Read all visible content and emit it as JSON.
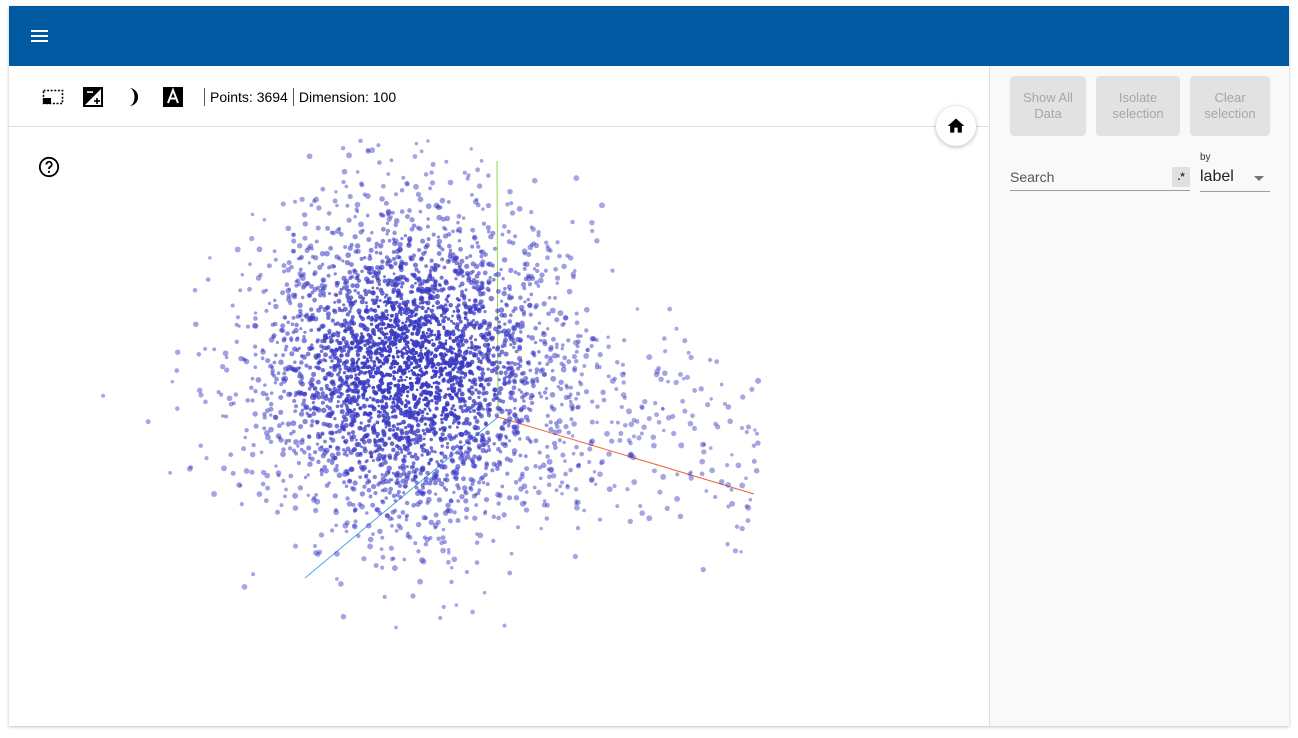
{
  "toolbar": {
    "icons": [
      "select-region-icon",
      "night-mode-icon",
      "label-toggle-icon"
    ],
    "points_label": "Points: 3694",
    "dimension_label": "Dimension: 100"
  },
  "sidebar": {
    "show_all": "Show All Data",
    "isolate": "Isolate selection",
    "clear": "Clear selection",
    "search_placeholder": "Search",
    "regex_label": ".*",
    "by_label": "by",
    "by_value": "label"
  },
  "colors": {
    "appbar": "#0059a1",
    "point": "#3a3ac4",
    "axis_x": "#e8643c",
    "axis_y": "#9ad452",
    "axis_z": "#4aa4e6"
  },
  "chart_data": {
    "type": "scatter",
    "title": "",
    "point_count": 3694,
    "dimension": 100,
    "axes": [
      "x",
      "y",
      "z"
    ]
  }
}
